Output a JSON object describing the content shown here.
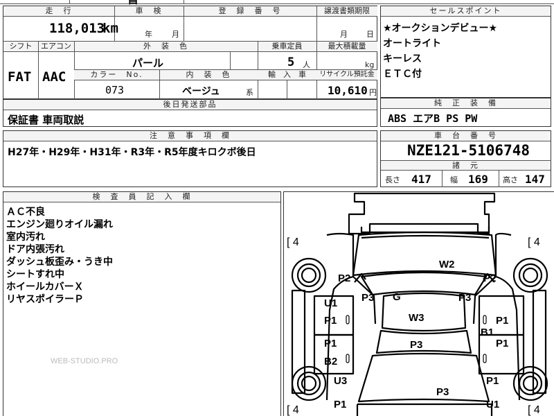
{
  "top_partial": "昌",
  "sheet": {
    "headers": {
      "mileage": "走　行",
      "shaken": "車　検",
      "registration": "登　録　番　号",
      "transfer_deadline": "譲渡書類期限",
      "shift": "シフト",
      "aircon": "エアコン",
      "exterior_color": "外　装　色",
      "capacity": "乗車定員",
      "max_load": "最大積載量",
      "color_no": "カラー　No.",
      "interior_color": "内　装　色",
      "import": "輸　入　車",
      "recycle": "リサイクル預託金",
      "later_parts": "後日発送部品",
      "notes": "注　意　事　項　欄",
      "sales_points": "セールスポイント",
      "standard_equipment": "純　正　装　備",
      "chassis_no": "車　台　番　号",
      "dimensions": "諸　元",
      "inspector": "検　査　員　記　入　欄"
    },
    "mileage_value": "118,013",
    "mileage_unit": "km",
    "shaken_year": "年",
    "shaken_month": "月",
    "transfer_month": "月",
    "transfer_day": "日",
    "shift_value": "FAT",
    "aircon_value": "AAC",
    "exterior_color_value": "パール",
    "capacity_value": "5",
    "capacity_unit": "人",
    "max_load_unit": "kg",
    "color_no_value": "073",
    "interior_color_value": "ベージュ",
    "interior_suffix": "系",
    "recycle_value": "10,610",
    "recycle_unit": "円",
    "later_parts_value": "保証書 車両取説",
    "notes_value": "H27年・H29年・H31年・R3年・R5年度キロクボ後日",
    "sales_points": [
      "★オークションデビュー★",
      "オートライト",
      "キーレス",
      "ＥＴＣ付"
    ],
    "equipment_value": "ABS エアB PS PW",
    "chassis_value": "NZE121-5106748",
    "dim_length_label": "長さ",
    "dim_length": "417",
    "dim_width_label": "幅",
    "dim_width": "169",
    "dim_height_label": "高さ",
    "dim_height": "147",
    "inspector_lines": [
      "ＡＣ不良",
      "エンジン廻りオイル漏れ",
      "室内汚れ",
      "ドア内張汚れ",
      "ダッシュ板歪み・うき中",
      "シートすれ中",
      "ホイールカバーＸ",
      "リヤスポイラーＰ"
    ],
    "watermark": "WEB-STUDIO.PRO"
  },
  "diagram": {
    "tire_tl": "[ 4",
    "tire_tr": "[ 4",
    "tire_bl": "[ 4",
    "tire_br": "[ 4",
    "marks": {
      "w2": "W2",
      "p2_left": "P2",
      "p2_right": "P2",
      "u1_left": "U1",
      "p3_left": "P3",
      "g": "G",
      "p3_right": "P3",
      "p1_left_upper": "P1",
      "w3": "W3",
      "p1_right_upper": "P1",
      "b1": "B1",
      "p1_left_mid": "P1",
      "p3_center": "P3",
      "p1_right_mid": "P1",
      "b2": "B2",
      "u3": "U3",
      "p1_right_lower": "P1",
      "p3_rear": "P3",
      "p1_left_bottom": "P1",
      "u1_right": "U1"
    }
  }
}
